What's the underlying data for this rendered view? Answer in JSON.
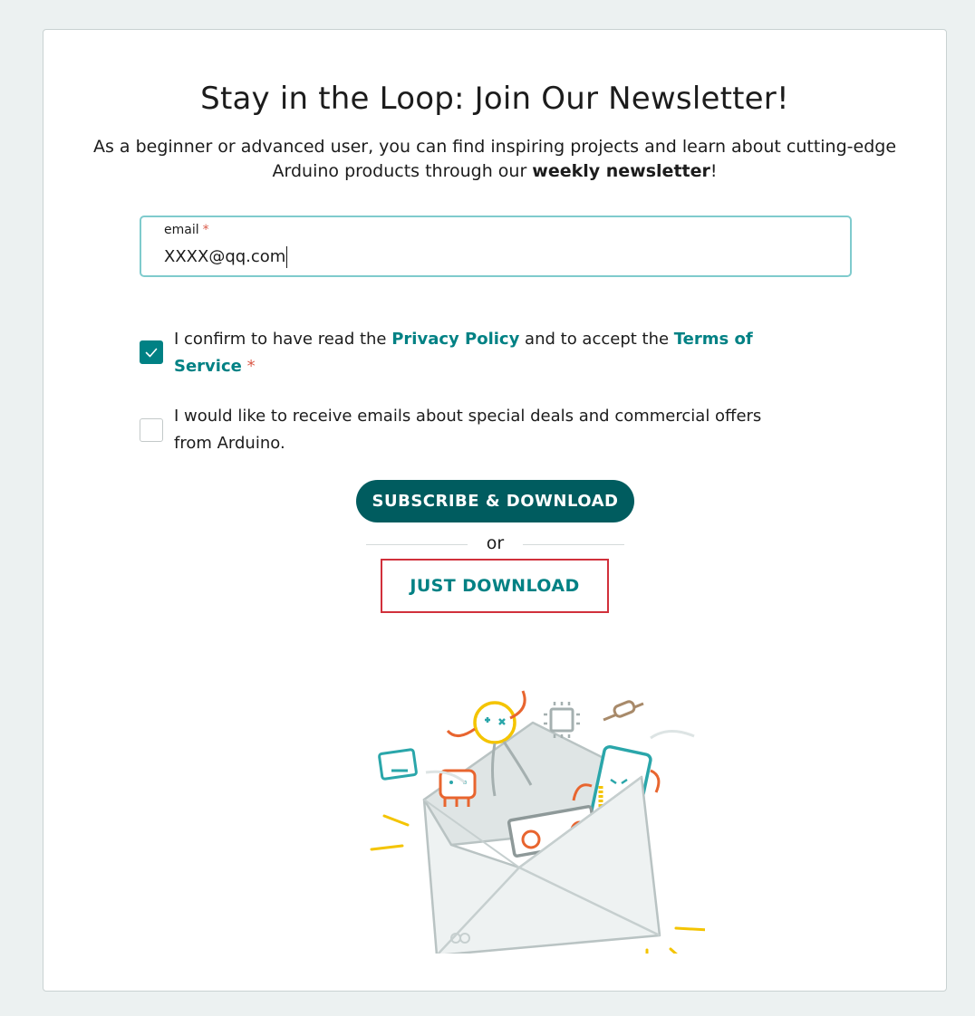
{
  "title": "Stay in the Loop: Join Our Newsletter!",
  "subtitle": {
    "text_before": "As a beginner or advanced user, you can find inspiring projects and learn about cutting-edge Arduino products through our ",
    "bold": "weekly newsletter",
    "text_after": "!"
  },
  "email": {
    "label": "email",
    "required_mark": "*",
    "value": "XXXX@qq.com"
  },
  "consent": {
    "checked": true,
    "text_1": "I confirm to have read the ",
    "privacy_link": "Privacy Policy",
    "text_2": " and to accept the ",
    "terms_link": "Terms of Service",
    "required_mark": "*"
  },
  "marketing": {
    "checked": false,
    "text": "I would like to receive emails about special deals and commercial offers from Arduino."
  },
  "buttons": {
    "subscribe": "SUBSCRIBE & DOWNLOAD",
    "or": "or",
    "just_download": "JUST DOWNLOAD"
  },
  "colors": {
    "teal": "#008184",
    "dark_teal": "#005c5f",
    "required": "#da5b4a",
    "highlight_border": "#d1303b"
  },
  "illustration": {
    "icon": "envelope-with-arduino-parts-icon"
  }
}
